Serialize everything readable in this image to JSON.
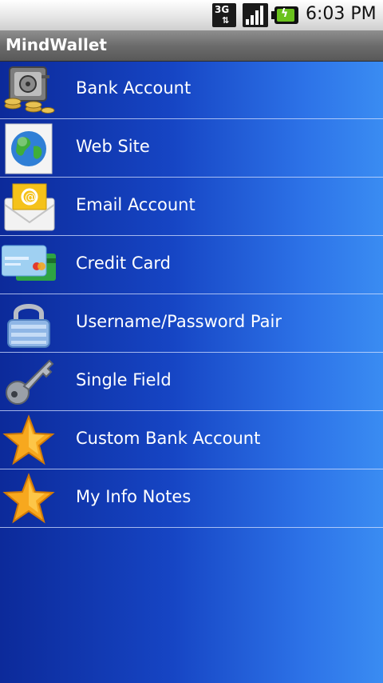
{
  "status_bar": {
    "network_label": "3G",
    "network_icon": "network-3g-icon",
    "signal_icon": "signal-bars-icon",
    "battery_icon": "battery-charging-icon",
    "time": "6:03 PM"
  },
  "app": {
    "title": "MindWallet"
  },
  "items": [
    {
      "label": "Bank Account",
      "icon": "bank-vault-icon"
    },
    {
      "label": "Web Site",
      "icon": "globe-icon"
    },
    {
      "label": "Email Account",
      "icon": "email-envelope-icon"
    },
    {
      "label": "Credit Card",
      "icon": "credit-card-icon"
    },
    {
      "label": "Username/Password Pair",
      "icon": "padlock-icon"
    },
    {
      "label": "Single Field",
      "icon": "key-icon"
    },
    {
      "label": "Custom Bank Account",
      "icon": "star-icon"
    },
    {
      "label": "My Info Notes",
      "icon": "star-icon"
    }
  ],
  "colors": {
    "list_bg_left": "#0c2a9a",
    "list_bg_right": "#3a8cf2",
    "title_bar": "#6c6c6c",
    "separator": "#d7e1ff"
  }
}
